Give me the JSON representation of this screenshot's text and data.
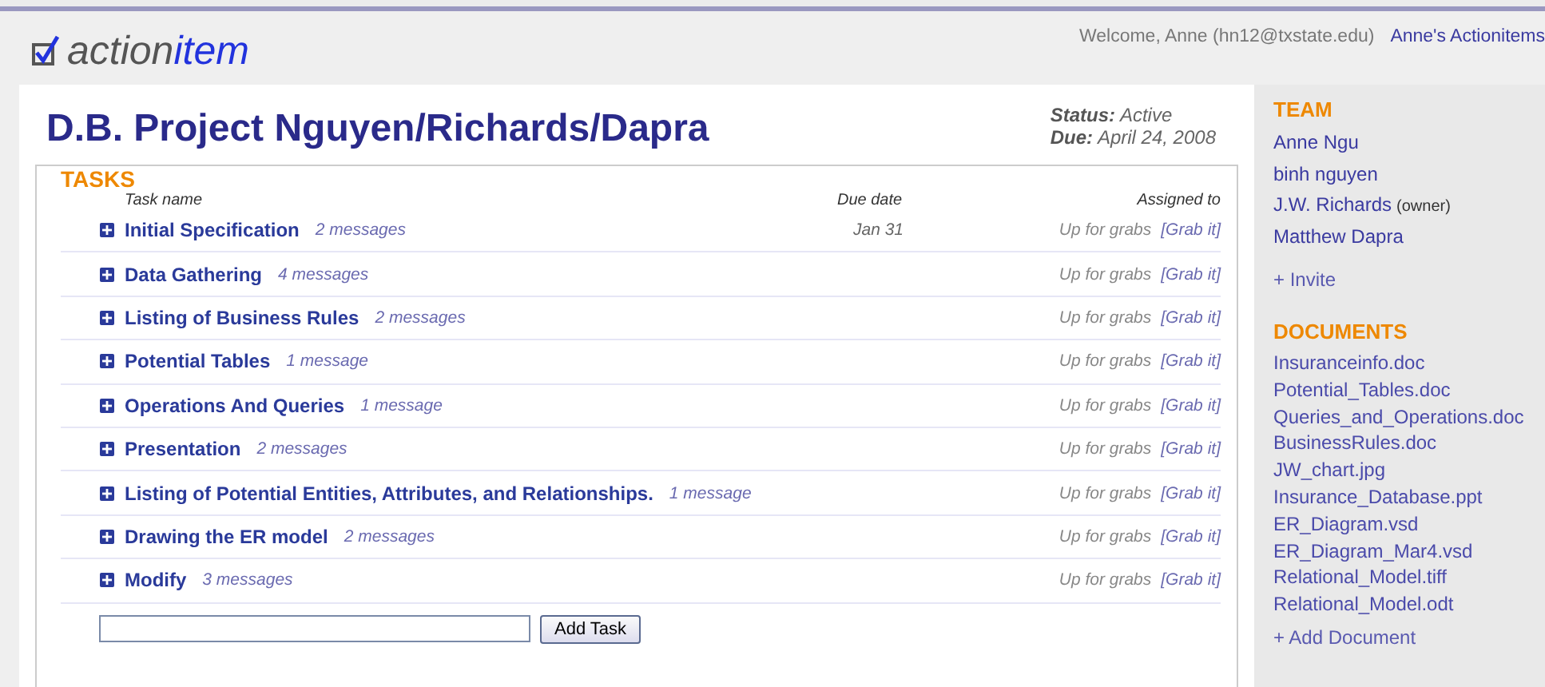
{
  "header": {
    "logo": {
      "prefix": "action",
      "suffix": "item"
    },
    "welcome": "Welcome, Anne (hn12@txstate.edu)",
    "user_link": "Anne's Actionitems"
  },
  "project": {
    "title": "D.B. Project Nguyen/Richards/Dapra",
    "status_label": "Status:",
    "status": "Active",
    "due_label": "Due:",
    "due": "April 24, 2008"
  },
  "tasks": {
    "heading": "TASKS",
    "columns": [
      "Task name",
      "Due date",
      "Assigned to"
    ],
    "rows": [
      {
        "name": "Initial Specification",
        "messages": "2 messages",
        "due": "Jan 31",
        "assigned": "Up for grabs",
        "grab": "[Grab it]",
        "expanded": false
      },
      {
        "name": "Data Gathering",
        "messages": "4 messages",
        "assigned": "Up for grabs",
        "grab": "[Grab it]",
        "expanded": false
      },
      {
        "name": "Listing of Business Rules",
        "messages": "2 messages",
        "assigned": "Up for grabs",
        "grab": "[Grab it]",
        "expanded": false
      },
      {
        "name": "Potential Tables",
        "messages": "1 message",
        "assigned": "Up for grabs",
        "grab": "[Grab it]",
        "expanded": false
      },
      {
        "name": "Operations And Queries",
        "messages": "1 message",
        "assigned": "Up for grabs",
        "grab": "[Grab it]",
        "expanded": false
      },
      {
        "name": "Presentation",
        "messages": "2 messages",
        "assigned": "Up for grabs",
        "grab": "[Grab it]",
        "expanded": false
      },
      {
        "name": "Listing of Potential Entities, Attributes, and Relationships.",
        "messages": "1 message",
        "assigned": "Up for grabs",
        "grab": "[Grab it]",
        "expanded": false
      },
      {
        "name": "Drawing the ER model",
        "messages": "2 messages",
        "assigned": "Up for grabs",
        "grab": "[Grab it]",
        "expanded": false
      },
      {
        "name": "Modify",
        "messages": "3 messages",
        "assigned": "Up for grabs",
        "grab": "[Grab it]",
        "expanded": false
      }
    ],
    "add_button": "Add Task"
  },
  "team": {
    "heading": "TEAM",
    "members": [
      {
        "name": "Anne Ngu"
      },
      {
        "name": "binh nguyen"
      },
      {
        "name": "J.W. Richards",
        "note": "(owner)"
      },
      {
        "name": "Matthew Dapra"
      }
    ],
    "invite": "+ Invite"
  },
  "documents": {
    "heading": "DOCUMENTS",
    "files": [
      "Insuranceinfo.doc",
      "Potential_Tables.doc",
      "Queries_and_Operations.doc",
      "BusinessRules.doc",
      "JW_chart.jpg",
      "Insurance_Database.ppt",
      "ER_Diagram.vsd",
      "ER_Diagram_Mar4.vsd",
      "Relational_Model.tiff",
      "Relational_Model.odt"
    ],
    "add": "+ Add Document"
  }
}
